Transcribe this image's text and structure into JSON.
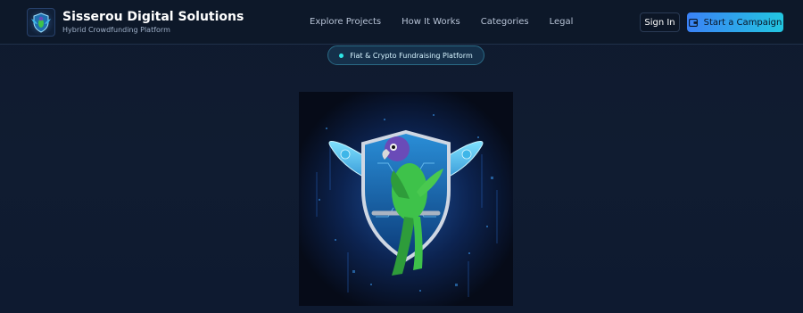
{
  "header": {
    "title": "Sisserou Digital Solutions",
    "subtitle": "Hybrid Crowdfunding Platform",
    "logo_icon": "parrot-shield-logo-icon"
  },
  "nav": {
    "links": [
      "Explore Projects",
      "How It Works",
      "Categories",
      "Legal"
    ]
  },
  "actions": {
    "sign_in": "Sign In",
    "start_campaign": "Start a Campaign",
    "start_campaign_icon": "campaign-icon"
  },
  "hero": {
    "badge": "Fiat & Crypto Fundraising Platform",
    "image_icon": "parrot-shield-emblem-icon"
  },
  "colors": {
    "background": "#0f1a2e",
    "accent_start": "#3b82f6",
    "accent_end": "#22c6e0",
    "badge_dot": "#2ee6e6"
  }
}
